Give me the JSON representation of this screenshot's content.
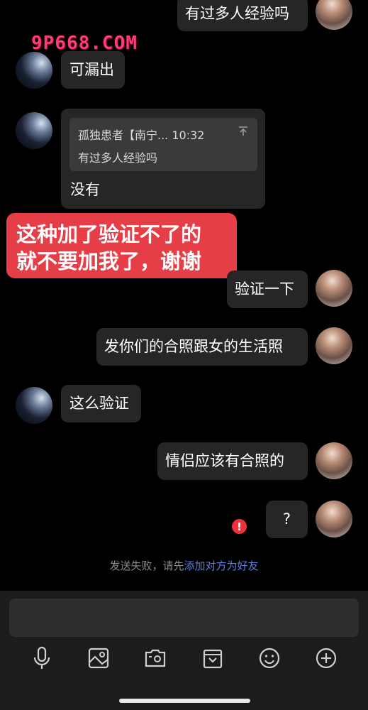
{
  "watermark": "9P668.COM",
  "messages": {
    "m1_self": "有过多人经验吗",
    "m2_peer": "可漏出",
    "m3_peer_reply": "没有",
    "quote": {
      "sender": "孤独患者【南宁...",
      "time": "10:32",
      "text": "有过多人经验吗"
    },
    "m4_self": "验证一下",
    "m5_self": "发你们的合照跟女的生活照",
    "m6_peer": "这么验证",
    "m7_self": "情侣应该有合照的",
    "m8_self": "?"
  },
  "banner": {
    "line1": "这种加了验证不了的",
    "line2": "就不要加我了，谢谢"
  },
  "notice": {
    "prefix": "发送失败，请先",
    "link": "添加对方为好友"
  },
  "error_glyph": "!",
  "toolbar": {
    "icons": [
      "microphone-icon",
      "image-icon",
      "camera-icon",
      "file-icon",
      "emoji-icon",
      "plus-icon"
    ]
  },
  "colors": {
    "background": "#000000",
    "bubble": "#262626",
    "banner": "#e63e47",
    "link": "#5b7fe0",
    "error": "#f2303c"
  }
}
